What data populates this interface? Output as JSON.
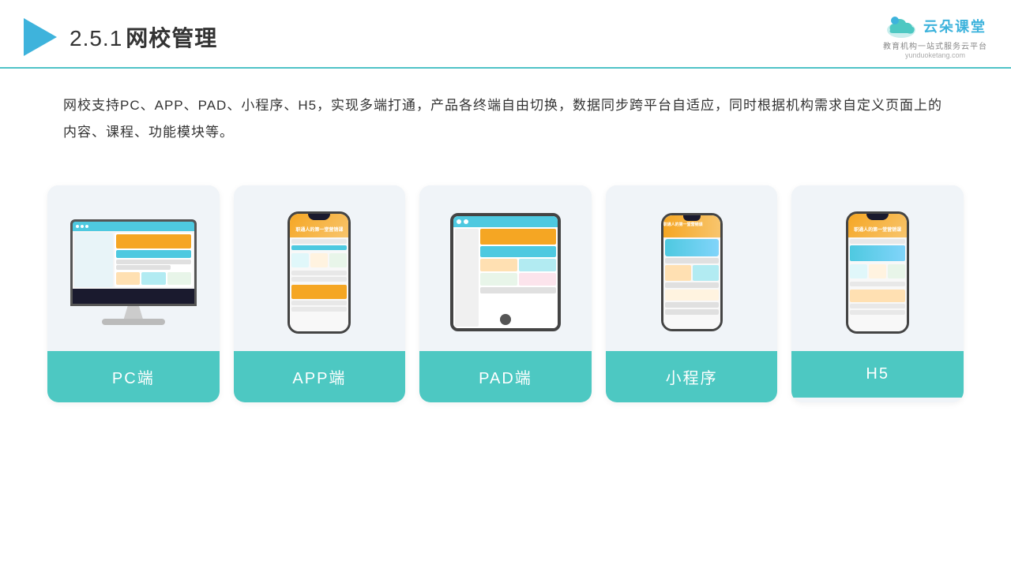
{
  "header": {
    "section": "2.5.1",
    "title": "网校管理",
    "logo_main": "云朵课堂",
    "logo_url": "yunduoketang.com",
    "logo_sub": "教育机构一站\n式服务云平台"
  },
  "description": {
    "text": "网校支持PC、APP、PAD、小程序、H5，实现多端打通，产品各终端自由切换，数据同步跨平台自适应，同时根据机构需求自定义页面上的内容、课程、功能模块等。"
  },
  "cards": [
    {
      "id": "pc",
      "label": "PC端"
    },
    {
      "id": "app",
      "label": "APP端"
    },
    {
      "id": "pad",
      "label": "PAD端"
    },
    {
      "id": "mini",
      "label": "小程序"
    },
    {
      "id": "h5",
      "label": "H5"
    }
  ],
  "colors": {
    "teal": "#4DC8C2",
    "blue": "#3EB3DC",
    "accent_orange": "#f5a623",
    "bg_card": "#f0f4f8"
  }
}
